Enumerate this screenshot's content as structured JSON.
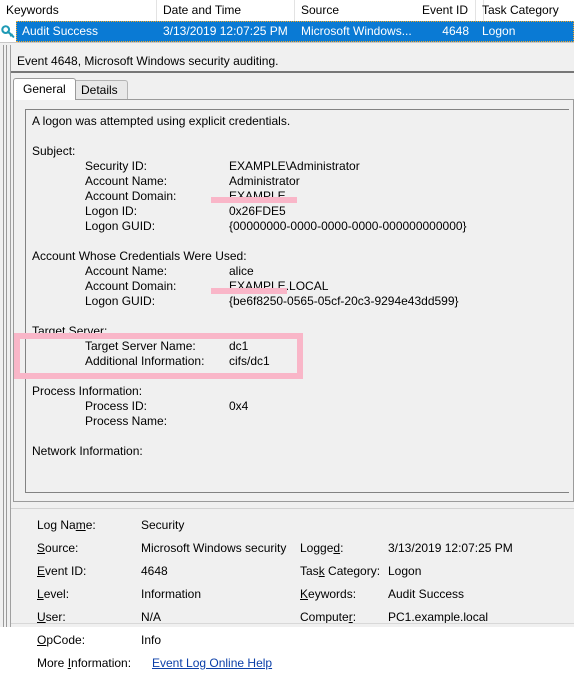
{
  "colors": {
    "selection_blue": "#0a7ad4",
    "annotation_pink": "#f9b6c8",
    "window_bg": "#f0f0f0",
    "link_blue": "#0b3fa8",
    "focus_orange": "#f5a623"
  },
  "event_list": {
    "columns": [
      {
        "label": "Keywords",
        "key": "keywords",
        "align": "left"
      },
      {
        "label": "Date and Time",
        "key": "date_and_time",
        "align": "left"
      },
      {
        "label": "Source",
        "key": "source",
        "align": "left"
      },
      {
        "label": "Event ID",
        "key": "event_id",
        "align": "right"
      },
      {
        "label": "Task Category",
        "key": "task_category",
        "align": "left"
      }
    ],
    "rows": [
      {
        "icon": "key-icon",
        "keywords": "Audit Success",
        "date_and_time": "3/13/2019 12:07:25 PM",
        "source": "Microsoft Windows...",
        "event_id": "4648",
        "task_category": "Logon",
        "selected": true
      }
    ]
  },
  "detail": {
    "banner": "Event 4648, Microsoft Windows security auditing.",
    "tabs": [
      {
        "label": "General",
        "active": true
      },
      {
        "label": "Details",
        "active": false
      }
    ],
    "description": {
      "headline": "A logon was attempted using explicit credentials.",
      "sections": [
        {
          "heading": "Subject:",
          "fields": [
            {
              "label": "Security ID:",
              "value": "EXAMPLE\\Administrator"
            },
            {
              "label": "Account Name:",
              "value": "Administrator",
              "annotated": true
            },
            {
              "label": "Account Domain:",
              "value": "EXAMPLE"
            },
            {
              "label": "Logon ID:",
              "value": "0x26FDE5"
            },
            {
              "label": "Logon GUID:",
              "value": "{00000000-0000-0000-0000-000000000000}"
            }
          ]
        },
        {
          "heading": "Account Whose Credentials Were Used:",
          "fields": [
            {
              "label": "Account Name:",
              "value": "alice",
              "annotated": true
            },
            {
              "label": "Account Domain:",
              "value": "EXAMPLE.LOCAL"
            },
            {
              "label": "Logon GUID:",
              "value": "{be6f8250-0565-05cf-20c3-9294e43dd599}"
            }
          ]
        },
        {
          "heading": "Target Server:",
          "annotated_box": true,
          "fields": [
            {
              "label": "Target Server Name:",
              "value": "dc1"
            },
            {
              "label": "Additional Information:",
              "value": "cifs/dc1"
            }
          ]
        },
        {
          "heading": "Process Information:",
          "fields": [
            {
              "label": "Process ID:",
              "value": "0x4"
            },
            {
              "label": "Process Name:",
              "value": ""
            }
          ]
        },
        {
          "heading": "Network Information:",
          "clipped": true,
          "fields": []
        }
      ]
    }
  },
  "summary": {
    "log_name_label": "Log Name:",
    "log_name_value": "Security",
    "source_label": "Source:",
    "source_value": "Microsoft Windows security",
    "logged_label": "Logged:",
    "logged_value": "3/13/2019 12:07:25 PM",
    "event_id_label": "Event ID:",
    "event_id_value": "4648",
    "task_category_label": "Task Category:",
    "task_category_value": "Logon",
    "level_label": "Level:",
    "level_value": "Information",
    "keywords_label": "Keywords:",
    "keywords_value": "Audit Success",
    "user_label": "User:",
    "user_value": "N/A",
    "computer_label": "Computer:",
    "computer_value": "PC1.example.local",
    "opcode_label": "OpCode:",
    "opcode_value": "Info",
    "more_information_label": "More Information:",
    "more_information_link": "Event Log Online Help"
  }
}
